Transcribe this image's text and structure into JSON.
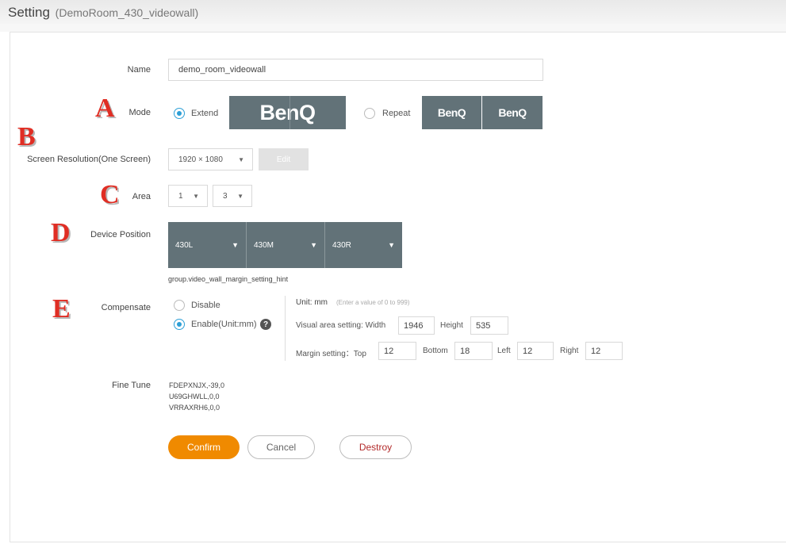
{
  "header": {
    "title": "Setting",
    "subtitle": "(DemoRoom_430_videowall)"
  },
  "markers": {
    "a": "A",
    "b": "B",
    "c": "C",
    "d": "D",
    "e": "E"
  },
  "name_row": {
    "label": "Name",
    "value": "demo_room_videowall"
  },
  "mode_row": {
    "label": "Mode",
    "extend_label": "Extend",
    "repeat_label": "Repeat",
    "selected": "Extend",
    "extend_logo": "BenQ",
    "repeat_logos": [
      "BenQ",
      "BenQ"
    ]
  },
  "resolution_row": {
    "label": "Screen Resolution(One Screen)",
    "value": "1920 × 1080",
    "edit_label": "Edit"
  },
  "area_row": {
    "label": "Area",
    "rows": "1",
    "cols": "3"
  },
  "device_row": {
    "label": "Device Position",
    "devices": [
      "430L",
      "430M",
      "430R"
    ],
    "hint": "group.video_wall_margin_setting_hint"
  },
  "compensate_row": {
    "label": "Compensate",
    "disable_label": "Disable",
    "enable_label": "Enable(Unit:mm)",
    "selected": "Enable(Unit:mm)",
    "unit_label": "Unit: mm",
    "unit_hint": "(Enter a value of 0 to 999)",
    "visual_label": "Visual area setting: Width",
    "width_value": "1946",
    "height_label": "Height",
    "height_value": "535",
    "margin_label": "Margin setting：Top",
    "top_value": "12",
    "bottom_label": "Bottom",
    "bottom_value": "18",
    "left_label": "Left",
    "left_value": "12",
    "right_label": "Right",
    "right_value": "12"
  },
  "fine_tune_row": {
    "label": "Fine Tune",
    "lines": [
      "FDEPXNJX,-39,0",
      "U69GHWLL,0,0",
      "VRRAXRH6,0,0"
    ]
  },
  "actions": {
    "confirm": "Confirm",
    "cancel": "Cancel",
    "destroy": "Destroy"
  },
  "colors": {
    "accent": "#f08a00",
    "radio": "#2d9fd6",
    "tile": "#627278",
    "marker": "#e02e24",
    "destroy": "#b22a2a"
  }
}
